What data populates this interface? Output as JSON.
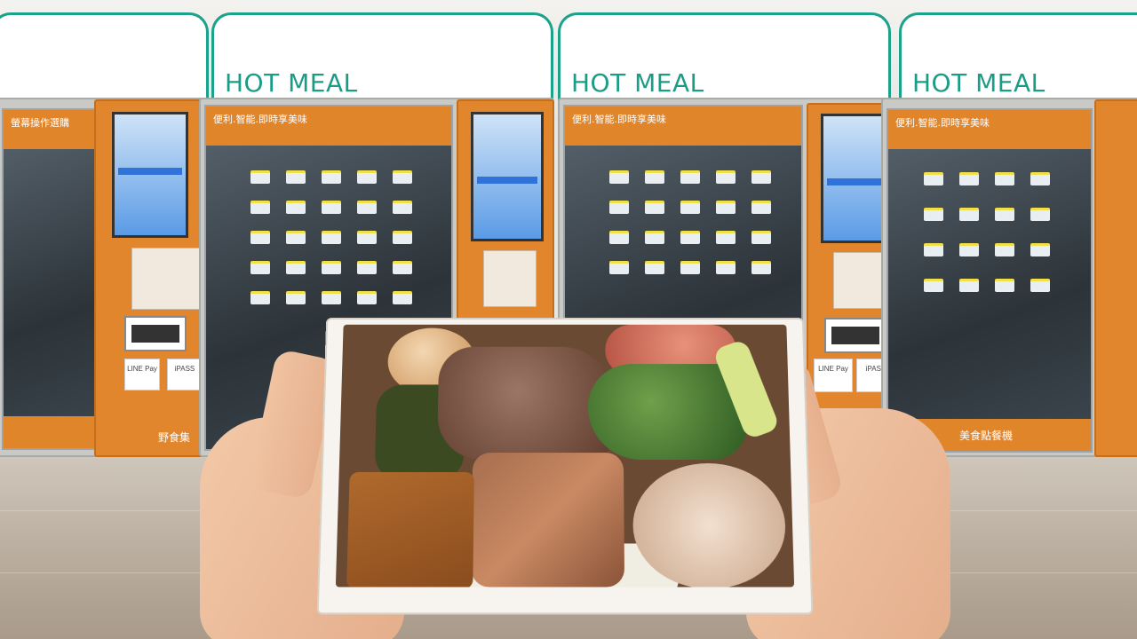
{
  "signs": [
    {
      "text": "HOT MEAL"
    },
    {
      "text": "HOT MEAL"
    },
    {
      "text": "HOT MEAL"
    }
  ],
  "machines": [
    {
      "header": "便利.智能.即時享美味",
      "touch_label": "螢幕操作選購"
    },
    {
      "header": "便利.智能.即時享美味",
      "touch_label": "螢幕操作選購"
    },
    {
      "header": "便利.智能.即時享美味",
      "touch_label": "螢幕操作選購"
    }
  ],
  "payment_logos": [
    "LINE Pay",
    "iPASS"
  ],
  "bottom_band_text": "美食點餐機",
  "brand_text": "野食集",
  "colors": {
    "sign_green": "#1aa38a",
    "machine_orange": "#e1852b",
    "floor": "#bdb1a3"
  },
  "scene_description_icons": [
    "bento-box-icon",
    "vending-machine-icon",
    "hand-icon"
  ]
}
